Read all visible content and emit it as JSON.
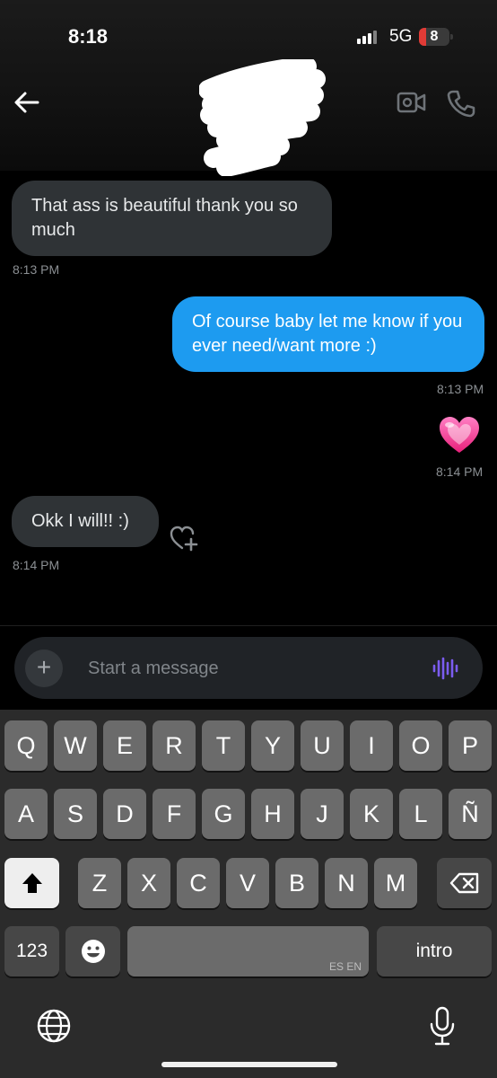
{
  "status_bar": {
    "time": "8:18",
    "network": "5G",
    "battery": "8"
  },
  "header": {
    "back_icon": "arrow-left-icon",
    "video_icon": "video-camera-icon",
    "call_icon": "phone-icon",
    "contact_name_redacted": true
  },
  "messages": [
    {
      "direction": "received",
      "text": "That ass is beautiful thank you so much",
      "time": "8:13 PM"
    },
    {
      "direction": "sent",
      "text": "Of course baby let me know if you ever need/want more :)",
      "time": "8:13 PM"
    },
    {
      "direction": "sent",
      "emoji": "💗",
      "time": "8:14 PM"
    },
    {
      "direction": "received",
      "text": "Okk I will!! :)",
      "time": "8:14 PM",
      "reaction_icon": "heart-plus-icon"
    }
  ],
  "composer": {
    "add_label": "+",
    "placeholder": "Start a message",
    "voice_icon": "waveform-icon",
    "accent": "#7b5cf0"
  },
  "keyboard": {
    "row1": [
      "Q",
      "W",
      "E",
      "R",
      "T",
      "Y",
      "U",
      "I",
      "O",
      "P"
    ],
    "row2": [
      "A",
      "S",
      "D",
      "F",
      "G",
      "H",
      "J",
      "K",
      "L",
      "Ñ"
    ],
    "row3": [
      "Z",
      "X",
      "C",
      "V",
      "B",
      "N",
      "M"
    ],
    "numbers_label": "123",
    "space_label": "ES EN",
    "return_label": "intro"
  },
  "colors": {
    "sent_bubble": "#1d9bf0",
    "received_bubble": "#2f3336",
    "timestamp": "#8b8f93"
  }
}
